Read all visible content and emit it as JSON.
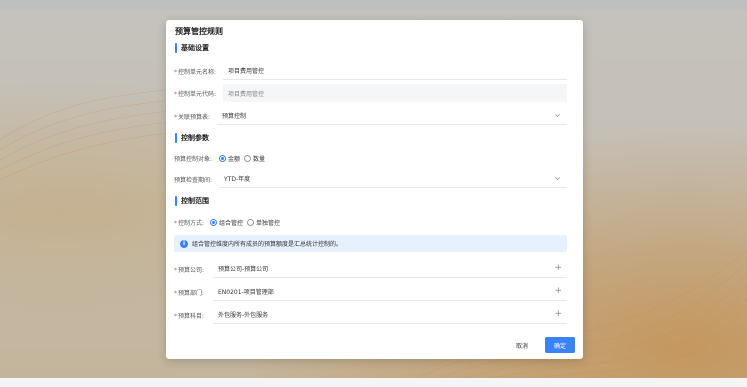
{
  "dialog": {
    "title": "预算管控规则",
    "sections": {
      "basic": "基础设置",
      "params": "控制参数",
      "scope": "控制范围"
    },
    "fields": {
      "unit_name": {
        "label": "控制单元名称:",
        "value": "项目费用管控"
      },
      "unit_code": {
        "label": "控制单元代码:",
        "value": "项目费用管控"
      },
      "related_table": {
        "label": "关联预算表:",
        "value": "预算控制"
      },
      "control_object": {
        "label": "预算控制对象:",
        "options": [
          "金额",
          "数量"
        ],
        "selected": "金额"
      },
      "check_period": {
        "label": "预算检查期间:",
        "value": "YTD-年度"
      },
      "control_mode": {
        "label": "控制方式:",
        "options": [
          "组合管控",
          "单独管控"
        ],
        "selected": "组合管控"
      },
      "company": {
        "label": "预算公司:",
        "value": "预算公司-预算公司"
      },
      "department": {
        "label": "预算部门:",
        "value": "EN0201-项目管理部"
      },
      "subject": {
        "label": "预算科目:",
        "value": "外包服务-外包服务"
      }
    },
    "notice": "组合管控维度内所有成员的预算额度是汇总统计控制的。",
    "buttons": {
      "cancel": "取消",
      "ok": "确定"
    }
  },
  "colors": {
    "accent": "#3b82f6",
    "required": "#e34d59"
  }
}
